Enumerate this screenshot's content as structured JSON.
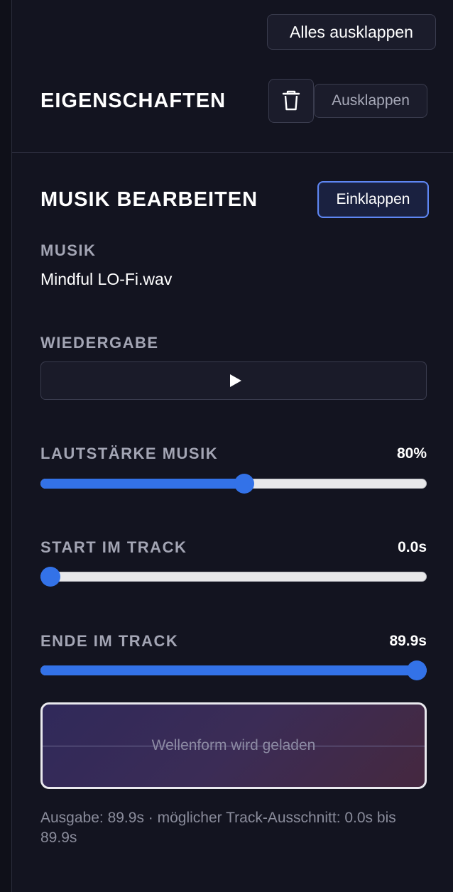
{
  "toolbar": {
    "expand_all_label": "Alles ausklappen"
  },
  "properties": {
    "title": "EIGENSCHAFTEN",
    "delete_icon": "trash-icon",
    "expand_label": "Ausklappen"
  },
  "music": {
    "title": "MUSIK BEARBEITEN",
    "collapse_label": "Einklappen",
    "file_label": "MUSIK",
    "file_name": "Mindful LO-Fi.wav",
    "playback_label": "WIEDERGABE",
    "play_icon": "play-icon",
    "volume": {
      "label": "LAUTSTÄRKE MUSIK",
      "value_text": "80%",
      "fraction": 0.53
    },
    "start": {
      "label": "START IM TRACK",
      "value_text": "0.0s",
      "fraction": 0.0
    },
    "end": {
      "label": "ENDE IM TRACK",
      "value_text": "89.9s",
      "fraction": 1.0
    },
    "waveform_text": "Wellenform wird geladen",
    "footer_text": "Ausgabe: 89.9s · möglicher Track-Ausschnitt: 0.0s bis 89.9s"
  },
  "colors": {
    "background": "#131420",
    "accent": "#3372e8",
    "focus_border": "#5f86f2"
  }
}
